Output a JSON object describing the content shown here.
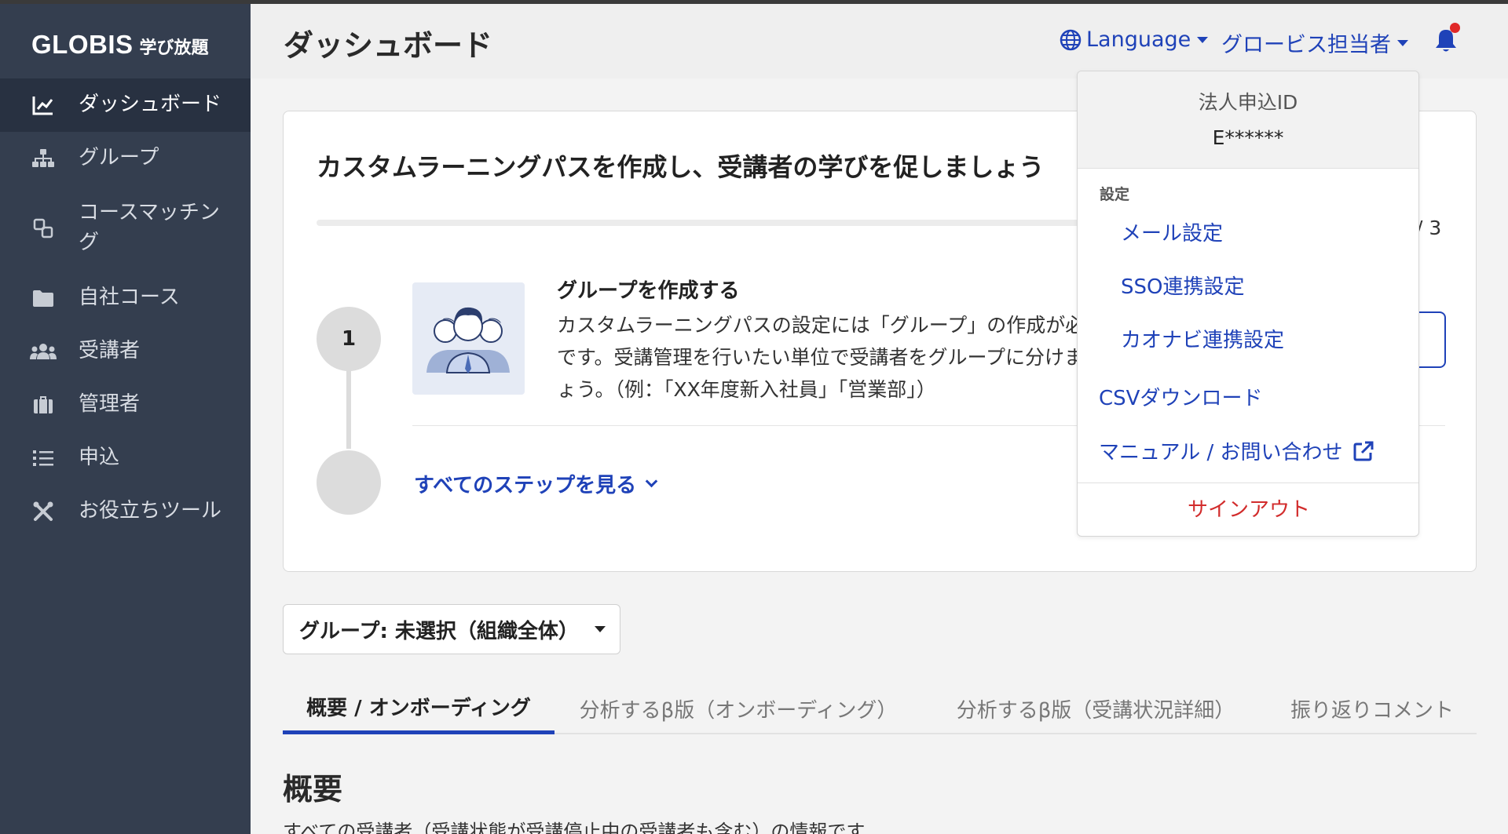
{
  "brand": {
    "name": "GLOBIS",
    "sub": "学び放題"
  },
  "sidebar": {
    "items": [
      {
        "label": "ダッシュボード",
        "icon": "chart-line-icon"
      },
      {
        "label": "グループ",
        "icon": "sitemap-icon"
      },
      {
        "label": "コースマッチング",
        "icon": "matching-icon"
      },
      {
        "label": "自社コース",
        "icon": "folder-icon"
      },
      {
        "label": "受講者",
        "icon": "users-icon"
      },
      {
        "label": "管理者",
        "icon": "briefcase-icon"
      },
      {
        "label": "申込",
        "icon": "list-icon"
      },
      {
        "label": "お役立ちツール",
        "icon": "tools-icon"
      }
    ]
  },
  "header": {
    "title": "ダッシュボード",
    "language": "Language",
    "user": "グロービス担当者"
  },
  "card": {
    "title": "カスタムラーニングパスを作成し、受講者の学びを促しましょう",
    "progress_count": "/ 3",
    "step_number": "1",
    "step_title": "グループを作成する",
    "step_desc": "カスタムラーニングパスの設定には「グループ」の作成が必要です。受講管理を行いたい単位で受講者をグループに分けましょう。（例：「XX年度新入社員」「営業部」）",
    "see_all": "すべてのステップを見る"
  },
  "group_select": {
    "label": "グループ: 未選択（組織全体）"
  },
  "tabs": [
    {
      "label": "概要 / オンボーディング"
    },
    {
      "label": "分析するβ版（オンボーディング）"
    },
    {
      "label": "分析するβ版（受講状況詳細）"
    },
    {
      "label": "振り返りコメント"
    }
  ],
  "section": {
    "title": "概要",
    "desc": "すべての受講者（受講状態が受講停止中の受講者も含む）の情報です"
  },
  "dropdown": {
    "id_label": "法人申込ID",
    "id_value": "E******",
    "section_label": "設定",
    "mail": "メール設定",
    "sso": "SSO連携設定",
    "kaonavi": "カオナビ連携設定",
    "csv": "CSVダウンロード",
    "manual": "マニュアル / お問い合わせ",
    "signout": "サインアウト"
  },
  "colors": {
    "accent": "#1f42b8",
    "sidebar": "#343e4f",
    "danger": "#d22c2c",
    "notification": "#e02828"
  }
}
